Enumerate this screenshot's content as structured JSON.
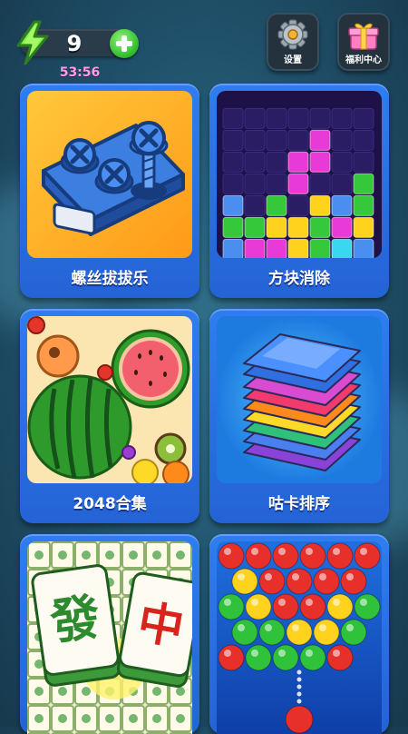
{
  "energy": {
    "count": "9",
    "timer": "53:56"
  },
  "top_buttons": [
    {
      "label": "设置",
      "icon": "gear-icon"
    },
    {
      "label": "福利中心",
      "icon": "gift-icon"
    }
  ],
  "games": [
    {
      "title": "螺丝拔拔乐"
    },
    {
      "title": "方块消除"
    },
    {
      "title": "2048合集"
    },
    {
      "title": "咕卡排序"
    },
    {
      "title": ""
    },
    {
      "title": ""
    }
  ],
  "mahjong_glyphs": {
    "tile1": "發",
    "tile2": "中"
  },
  "colors": {
    "card_blue": "#2b72e8",
    "accent_green": "#2fbb2a",
    "timer_pink": "#ff9ee8"
  }
}
